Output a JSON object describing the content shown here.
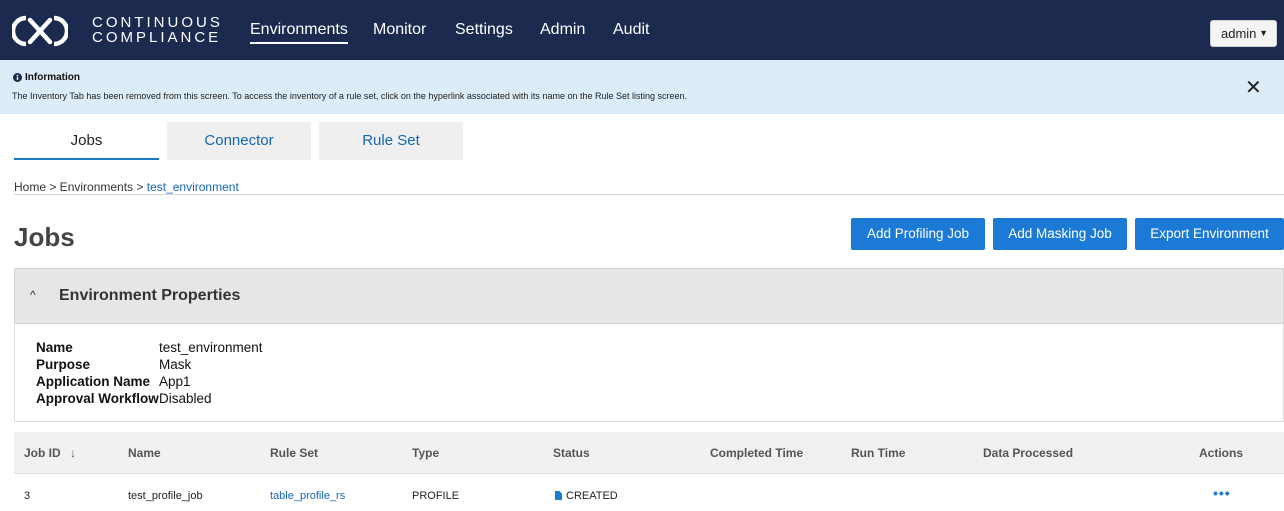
{
  "header": {
    "brand_line1": "CONTINUOUS",
    "brand_line2": "COMPLIANCE",
    "nav": [
      {
        "label": "Environments"
      },
      {
        "label": "Monitor"
      },
      {
        "label": "Settings"
      },
      {
        "label": "Admin"
      },
      {
        "label": "Audit"
      }
    ],
    "user": "admin"
  },
  "banner": {
    "title": "Information",
    "text": "The Inventory Tab has been removed from this screen. To access the inventory of a rule set, click on the hyperlink associated with its name on the Rule Set listing screen."
  },
  "tabs": [
    {
      "label": "Jobs"
    },
    {
      "label": "Connector"
    },
    {
      "label": "Rule Set"
    }
  ],
  "breadcrumb": {
    "prefix": "Home > Environments > ",
    "current": "test_environment"
  },
  "page_title": "Jobs",
  "buttons": {
    "add_profiling": "Add Profiling Job",
    "add_masking": "Add Masking Job",
    "export_env": "Export Environment"
  },
  "properties": {
    "title": "Environment Properties",
    "items": [
      {
        "label": "Name",
        "value": "test_environment"
      },
      {
        "label": "Purpose",
        "value": "Mask"
      },
      {
        "label": "Application Name",
        "value": "App1"
      },
      {
        "label": "Approval Workflow",
        "value": "Disabled"
      }
    ]
  },
  "table": {
    "columns": [
      "Job ID",
      "Name",
      "Rule Set",
      "Type",
      "Status",
      "Completed Time",
      "Run Time",
      "Data Processed",
      "Actions"
    ],
    "sort_arrow": "↓",
    "rows": [
      {
        "job_id": "3",
        "name": "test_profile_job",
        "rule_set": "table_profile_rs",
        "type": "PROFILE",
        "status": "CREATED",
        "completed_time": "",
        "run_time": "",
        "data_processed": "",
        "actions": "•••"
      }
    ]
  },
  "colors": {
    "nav_bg": "#1b2a4e",
    "banner_bg": "#dcecf8",
    "primary": "#1b7ad6",
    "link": "#1467b3"
  }
}
